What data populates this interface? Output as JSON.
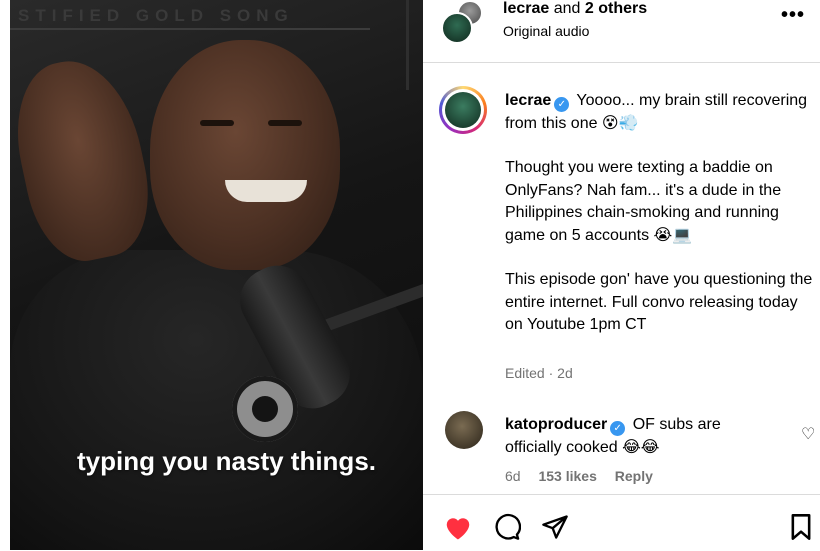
{
  "video": {
    "wall_text": "STIFIED GOLD SONG",
    "caption": "typing you nasty things."
  },
  "header": {
    "username": "lecrae",
    "collab_connector": "and",
    "others": "2 others",
    "audio": "Original audio",
    "more_icon": "ellipsis-icon",
    "more_glyph": "•••"
  },
  "post": {
    "username": "lecrae",
    "verified_glyph": "✓",
    "line1": "Yoooo... my brain still recovering from this one 😵💨",
    "para2": "Thought you were texting a baddie on OnlyFans? Nah fam... it's a dude in the Philippines chain-smoking and running game on 5 accounts 😭💻",
    "para3": "This episode gon' have you questioning the entire internet. Full convo releasing today on Youtube 1pm CT",
    "edited": "Edited",
    "separator": "·",
    "time": "2d"
  },
  "comment": {
    "username": "katoproducer",
    "verified_glyph": "✓",
    "text": "OF subs are officially cooked 😂😂",
    "time": "6d",
    "likes": "153 likes",
    "reply": "Reply",
    "like_glyph": "♡"
  },
  "actions": {
    "like_icon": "heart-filled-icon",
    "comment_icon": "comment-icon",
    "share_icon": "send-icon",
    "save_icon": "bookmark-icon",
    "like_color": "#ff3040"
  }
}
